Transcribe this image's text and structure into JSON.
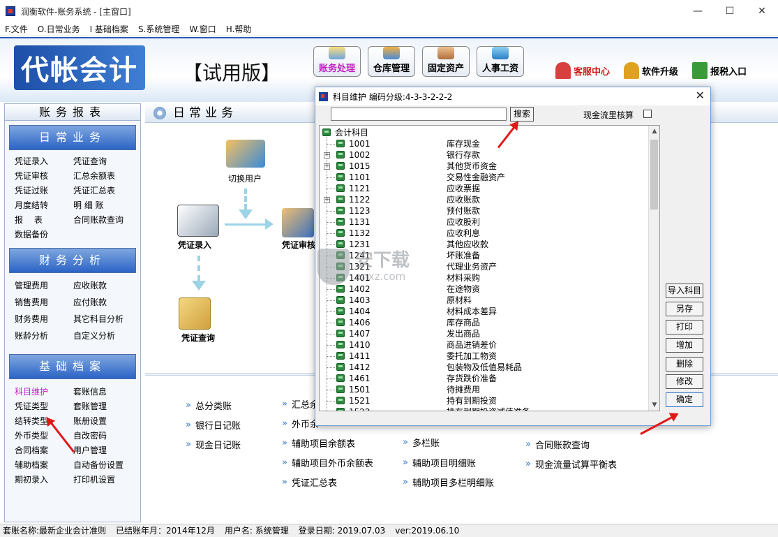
{
  "window": {
    "title": "润衡软件-账务系统 - [主窗口]",
    "min": "—",
    "max": "☐",
    "close": "✕"
  },
  "menu": [
    "F.文件",
    "O.日常业务",
    "I 基础档案",
    "S.系统管理",
    "W.窗口",
    "H.帮助"
  ],
  "banner": {
    "logo": "代帐会计",
    "trial": "【试用版】",
    "modules": [
      "账务处理",
      "仓库管理",
      "固定资产",
      "人事工资"
    ],
    "top_links": [
      "客服中心",
      "软件升级",
      "报税入口"
    ]
  },
  "left": {
    "header": "账务报表",
    "sections": [
      {
        "title": "日常业务",
        "links": [
          "凭证录入",
          "凭证查询",
          "凭证审核",
          "汇总余额表",
          "凭证过账",
          "凭证汇总表",
          "月度结转",
          "明 细 账",
          "报　 表",
          "合同账款查询",
          "数据备份"
        ]
      },
      {
        "title": "财务分析",
        "links": [
          "管理费用",
          "应收账款",
          "销售费用",
          "应付账款",
          "财务费用",
          "其它科目分析",
          "账龄分析",
          "自定义分析"
        ]
      },
      {
        "title": "基础档案",
        "links": [
          "科目维护",
          "套账信息",
          "凭证类型",
          "套账管理",
          "结转类型",
          "账册设置",
          "外币类型",
          "自改密码",
          "合同档案",
          "用户管理",
          "辅助档案",
          "自动备份设置",
          "期初录入",
          "打印机设置"
        ]
      }
    ]
  },
  "main": {
    "header": "日常业务",
    "flow": {
      "switch_user": "切换用户",
      "voucher_entry": "凭证录入",
      "voucher_audit": "凭证审核",
      "voucher_query": "凭证查询"
    },
    "reports": [
      "总分类账",
      "汇总余",
      "银行日记账",
      "外币余",
      "现金日记账",
      "辅助项目余额表",
      "多栏账",
      "合同账款查询",
      "辅助项目外币余额表",
      "辅助项目明细账",
      "现金流量试算平衡表",
      "凭证汇总表",
      "辅助项目多栏明细账"
    ]
  },
  "dialog": {
    "title": "科目维护  编码分级:4-3-3-2-2-2",
    "search_value": "",
    "search_btn": "搜索",
    "cash_label": "现金流里核算",
    "root": "会计科目",
    "accounts": [
      {
        "code": "1001",
        "name": "库存现金",
        "expand": false
      },
      {
        "code": "1002",
        "name": "银行存款",
        "expand": true
      },
      {
        "code": "1015",
        "name": "其他货币资金",
        "expand": true
      },
      {
        "code": "1101",
        "name": "交易性金融资产",
        "expand": false
      },
      {
        "code": "1121",
        "name": "应收票据",
        "expand": false
      },
      {
        "code": "1122",
        "name": "应收账款",
        "expand": true
      },
      {
        "code": "1123",
        "name": "预付账款",
        "expand": false
      },
      {
        "code": "1131",
        "name": "应收股利",
        "expand": false
      },
      {
        "code": "1132",
        "name": "应收利息",
        "expand": false
      },
      {
        "code": "1231",
        "name": "其他应收款",
        "expand": false
      },
      {
        "code": "1241",
        "name": "坏账准备",
        "expand": false
      },
      {
        "code": "1321",
        "name": "代理业务资产",
        "expand": false
      },
      {
        "code": "1401",
        "name": "材料采购",
        "expand": false
      },
      {
        "code": "1402",
        "name": "在途物资",
        "expand": false
      },
      {
        "code": "1403",
        "name": "原材料",
        "expand": false
      },
      {
        "code": "1404",
        "name": "材料成本差异",
        "expand": false
      },
      {
        "code": "1406",
        "name": "库存商品",
        "expand": false
      },
      {
        "code": "1407",
        "name": "发出商品",
        "expand": false
      },
      {
        "code": "1410",
        "name": "商品进销差价",
        "expand": false
      },
      {
        "code": "1411",
        "name": "委托加工物资",
        "expand": false
      },
      {
        "code": "1412",
        "name": "包装物及低值易耗品",
        "expand": false
      },
      {
        "code": "1461",
        "name": "存货跌价准备",
        "expand": false
      },
      {
        "code": "1501",
        "name": "待摊费用",
        "expand": false
      },
      {
        "code": "1521",
        "name": "持有到期投资",
        "expand": false
      },
      {
        "code": "1522",
        "name": "持有到期投资减值准备",
        "expand": false
      }
    ],
    "buttons": [
      "导入科目",
      "另存",
      "打印",
      "增加",
      "删除",
      "修改",
      "确定"
    ]
  },
  "watermark": {
    "text": "安下载",
    "sub": "anxz.com"
  },
  "status": {
    "set_name": "套账名称:最新企业会计准则",
    "closed_month": "已结账年月：2014年12月",
    "user": "用户名: 系统管理",
    "login_date": "登录日期: 2019.07.03",
    "version": "ver:2019.06.10"
  }
}
